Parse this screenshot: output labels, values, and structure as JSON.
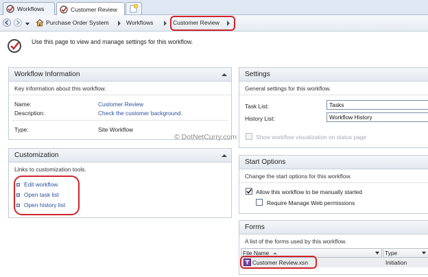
{
  "tabs": [
    {
      "label": "Workflows",
      "icon": "workflow-icon"
    },
    {
      "label": "Customer Review",
      "icon": "workflow-icon"
    }
  ],
  "breadcrumb": {
    "items": [
      "Purchase Order System",
      "Workflows",
      "Customer Review"
    ]
  },
  "header": {
    "text": "Use this page to view and manage settings for this workflow."
  },
  "workflow_info": {
    "title": "Workflow Information",
    "description": "Key information about this workflow.",
    "name_label": "Name:",
    "name_value": "Customer Review",
    "description_label": "Description:",
    "description_value": "Check the customer background.",
    "type_label": "Type:",
    "type_value": "Site Workflow"
  },
  "customization": {
    "title": "Customization",
    "description": "Links to customization tools.",
    "links": [
      "Edit workflow",
      "Open task list",
      "Open history list"
    ]
  },
  "settings": {
    "title": "Settings",
    "description": "General settings for this workflow.",
    "task_list_label": "Task List:",
    "task_list_value": "Tasks",
    "history_list_label": "History List:",
    "history_list_value": "Workflow History",
    "show_visualization_label": "Show workflow visualization on status page"
  },
  "start_options": {
    "title": "Start Options",
    "description": "Change the start options for this workflow.",
    "manual_start_label": "Allow this workflow to be manually started",
    "manual_start_checked": true,
    "require_manage_label": "Require Manage Web permissions",
    "require_manage_checked": false
  },
  "forms": {
    "title": "Forms",
    "description": "A list of the forms used by this workflow.",
    "columns": [
      "File Name",
      "Type"
    ],
    "rows": [
      {
        "file_name": "Customer Review.xsn",
        "type": "Initiation"
      }
    ]
  },
  "watermark": "© DotNetCurry.com",
  "colors": {
    "highlight": "#d0232b",
    "link": "#2a4f9c",
    "panel_border": "#c3cbd6"
  }
}
